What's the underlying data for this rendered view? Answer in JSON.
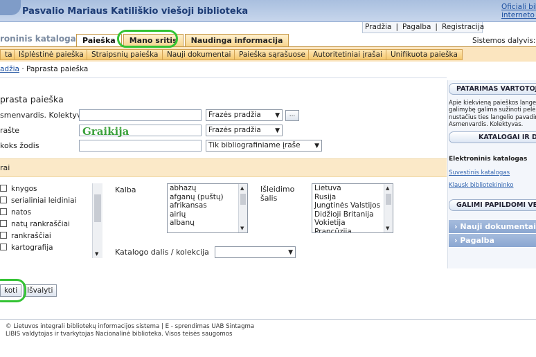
{
  "header": {
    "site_title": "Pasvalio Mariaus Katiliškio viešoji biblioteka",
    "top_link_1": "Oficiali bib",
    "top_link_2": "interneto s"
  },
  "util": {
    "home": "Pradžia",
    "help": "Pagalba",
    "register": "Registracija",
    "sep": "|"
  },
  "catalog_title": "roninis katalogas",
  "tabs": [
    {
      "label": "Paieška"
    },
    {
      "label": "Mano sritis"
    },
    {
      "label": "Naudinga informacija"
    }
  ],
  "dalyvis": "Sistemos dalyvis: S",
  "subnav": [
    "ta",
    "Išplėstinė paieška",
    "Straipsnių paieška",
    "Nauji dokumentai",
    "Paieška sąrašuose",
    "Autoritetiniai įrašai",
    "Unifikuota paieška"
  ],
  "breadcrumb": {
    "home": "adžia",
    "current": "· Paprasta paieška"
  },
  "form": {
    "title": "prasta paieška",
    "fields": [
      {
        "label": "smenvardis. Kolektyvas",
        "value": "",
        "mode": "Frazės pradžia"
      },
      {
        "label": "rašte",
        "value": "",
        "mode": "Frazės pradžia"
      },
      {
        "label": "koks žodis",
        "value": "",
        "mode": "Tik bibliografiniame įraše"
      }
    ],
    "dots": "...",
    "handwritten": "Graikija"
  },
  "filters": {
    "label": "rai",
    "types": [
      "knygos",
      "serialiniai leidiniai",
      "natos",
      "natų rankraščiai",
      "rankraščiai",
      "kartografija"
    ],
    "kalba_label": "Kalba",
    "kalba": [
      "abhazų",
      "afganų (puštų)",
      "afrikansas",
      "airių",
      "albanų"
    ],
    "salis_label_1": "Išleidimo",
    "salis_label_2": "šalis",
    "salis": [
      "Lietuva",
      "Rusija",
      "Jungtinės Valstijos",
      "Didžioji Britanija",
      "Vokietija",
      "Prancūzija"
    ],
    "katalogo_label": "Katalogo dalis / kolekcija"
  },
  "buttons": {
    "search": "koti",
    "clear": "Išvalyti"
  },
  "footer": {
    "line1": "© Lietuvos integrali bibliotekų informacijos sistema | E - sprendimas UAB Sintagma",
    "line2": "LIBIS valdytojas ir tvarkytojas Nacionalinė biblioteka. Visos teisės saugomos"
  },
  "sidebar": {
    "advice_head": "PATARIMAS VARTOTOJ",
    "advice_text": [
      "Apie kiekvieną paieškos langelį",
      "galimybę galima sužinoti pelės",
      "nustačius ties langelio pavadin",
      "Asmenvardis. Kolektyvas."
    ],
    "db_head": "KATALOGAI IR DB",
    "db_bold": "Elektroninis katalogas",
    "db_links": [
      "Suvestinis katalogas",
      "Klausk bibliotekininko"
    ],
    "extra_head": "GALIMI PAPILDOMI VEIK",
    "nav": [
      "Nauji dokumentai",
      "Pagalba"
    ]
  }
}
